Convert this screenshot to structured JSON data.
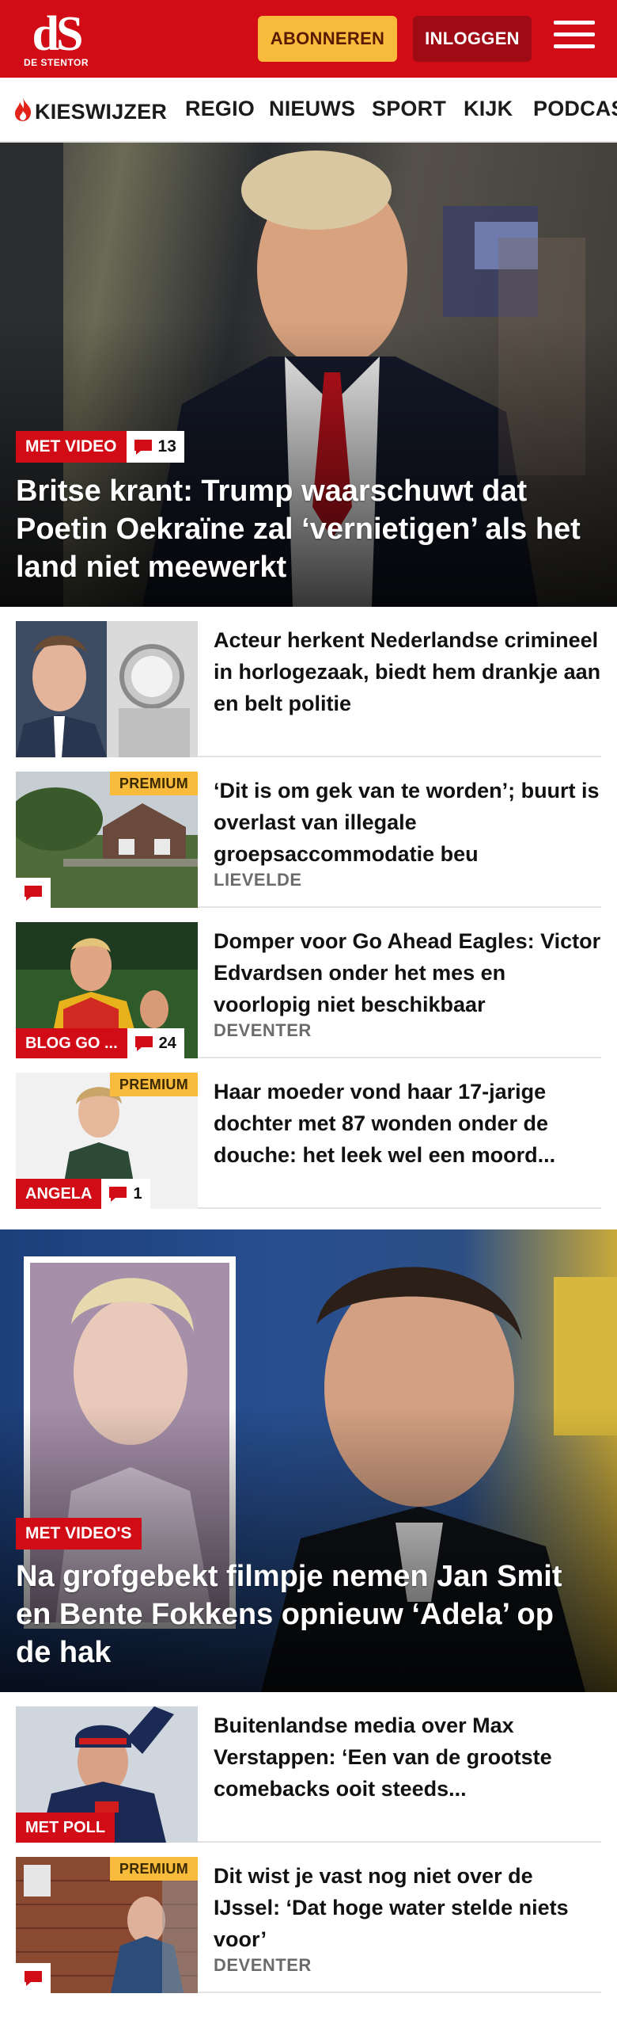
{
  "brand": {
    "logo_mark": "dS",
    "logo_name": "DE STENTOR",
    "color": "#d20c16"
  },
  "header": {
    "subscribe_label": "ABONNEREN",
    "login_label": "INLOGGEN"
  },
  "nav": {
    "items": [
      "KIESWIJZER",
      "REGIO",
      "NIEUWS",
      "SPORT",
      "KIJK",
      "PODCASTS"
    ]
  },
  "hero1": {
    "label": "MET VIDEO",
    "comments": "13",
    "title": "Britse krant: Trump waarschuwt dat Poetin Oekraïne zal ‘vernietigen’ als het land niet meewerkt"
  },
  "articles1": [
    {
      "title": "Acteur herkent Nederlandse crimineel in horlogezaak, biedt hem drankje aan en belt politie",
      "location": "",
      "premium": "",
      "label": "",
      "comments": ""
    },
    {
      "title": "‘Dit is om gek van te worden’; buurt is overlast van illegale groepsaccommodatie beu",
      "location": "LIEVELDE",
      "premium": "PREMIUM",
      "label": "",
      "comments": ""
    },
    {
      "title": "Domper voor Go Ahead Eagles: Victor Edvardsen onder het mes en voorlopig niet beschikbaar",
      "location": "DEVENTER",
      "premium": "",
      "label": "BLOG GO ...",
      "comments": "24"
    },
    {
      "title": "Haar moeder vond haar 17-jarige dochter met 87 wonden onder de douche: het leek wel een moord...",
      "location": "",
      "premium": "PREMIUM",
      "label": "ANGELA",
      "comments": "1"
    }
  ],
  "hero2": {
    "label": "MET VIDEO'S",
    "title": "Na grofgebekt filmpje nemen Jan Smit en Bente Fokkens opnieuw ‘Adela’ op de hak"
  },
  "articles2": [
    {
      "title": "Buitenlandse media over Max Verstappen: ‘Een van de grootste comebacks ooit steeds...",
      "location": "",
      "premium": "",
      "label": "MET POLL",
      "comments": ""
    },
    {
      "title": "Dit wist je vast nog niet over de IJssel: ‘Dat hoge water stelde niets voor’",
      "location": "DEVENTER",
      "premium": "PREMIUM",
      "label": "",
      "comments": ""
    }
  ]
}
